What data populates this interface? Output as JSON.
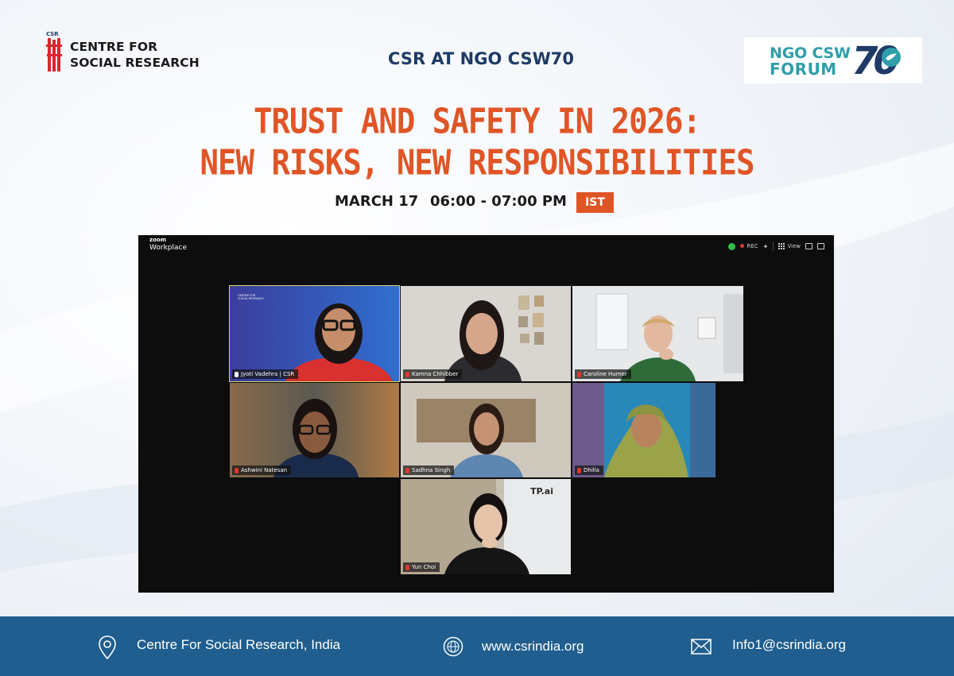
{
  "header": {
    "org_name_line1": "CENTRE FOR",
    "org_name_line2": "SOCIAL RESEARCH",
    "org_logo_text": "CSR",
    "event_label": "CSR AT NGO CSW70",
    "forum_logo": {
      "line1": "NGO CSW",
      "line2": "FORUM",
      "number": "70"
    }
  },
  "title": {
    "line1": "TRUST AND SAFETY IN 2026:",
    "line2": "NEW RISKS, NEW RESPONSIBILITIES"
  },
  "schedule": {
    "date": "MARCH 17",
    "time": "06:00 - 07:00 PM",
    "timezone": "IST"
  },
  "zoom": {
    "brand_top": "zoom",
    "brand_bottom": "Workplace",
    "rec_label": "REC",
    "view_label": "View",
    "participants": [
      {
        "name": "Jyoti Vadehra | CSR",
        "active": true,
        "logo_line1": "CENTRE FOR",
        "logo_line2": "SOCIAL RESEARCH"
      },
      {
        "name": "Kamna Chhibber"
      },
      {
        "name": "Caroline Humer"
      },
      {
        "name": "Ashwini Natesan"
      },
      {
        "name": "Sadhna Singh"
      },
      {
        "name": "Dhilla"
      },
      {
        "name": "Yun Choi",
        "logo": "TP.ai"
      }
    ]
  },
  "footer": {
    "organization": "Centre For Social Research, India",
    "website": "www.csrindia.org",
    "email": "Info1@csrindia.org"
  },
  "colors": {
    "accent_orange": "#e05526",
    "navy": "#1e3a66",
    "teal": "#2f9eaa",
    "footer_blue": "#1f5e8e"
  }
}
